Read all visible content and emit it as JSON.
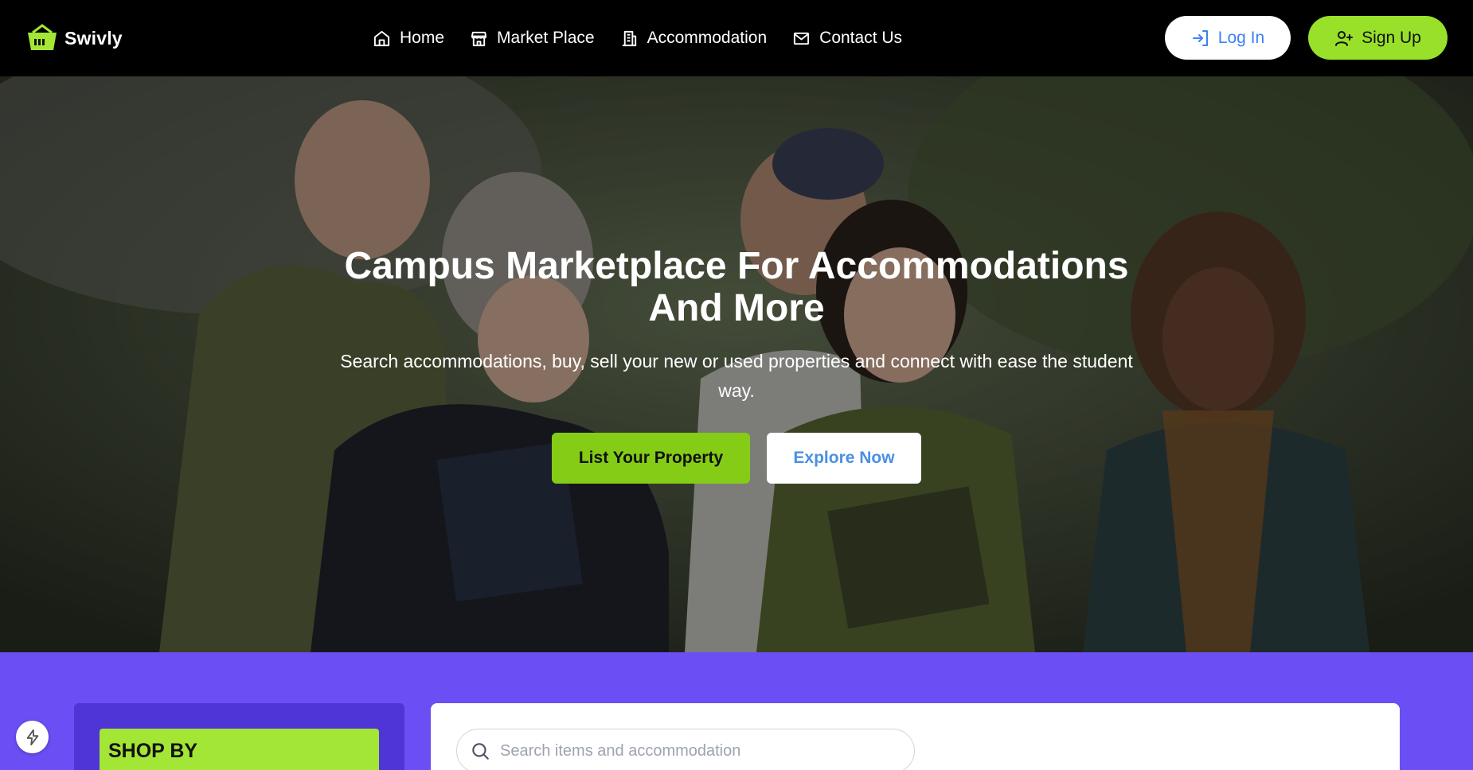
{
  "nav": {
    "brand": "Swivly",
    "links": [
      {
        "label": "Home",
        "icon": "home-icon"
      },
      {
        "label": "Market Place",
        "icon": "store-icon"
      },
      {
        "label": "Accommodation",
        "icon": "building-icon"
      },
      {
        "label": "Contact Us",
        "icon": "mail-icon"
      }
    ],
    "login_label": "Log In",
    "signup_label": "Sign Up"
  },
  "hero": {
    "title_line1": "Campus Marketplace For Accommodations",
    "title_line2": "And More",
    "subtitle": "Search accommodations, buy, sell your new or used properties and connect with ease the student way.",
    "primary_cta": "List Your Property",
    "secondary_cta": "Explore Now"
  },
  "shop": {
    "heading": "SHOP BY",
    "search_placeholder": "Search items and accommodation"
  },
  "colors": {
    "accent_green": "#84cc16",
    "signup_green": "#98e02a",
    "purple_bg": "#6b4ff5",
    "purple_panel": "#4f35d6",
    "link_blue": "#3b82f6"
  }
}
